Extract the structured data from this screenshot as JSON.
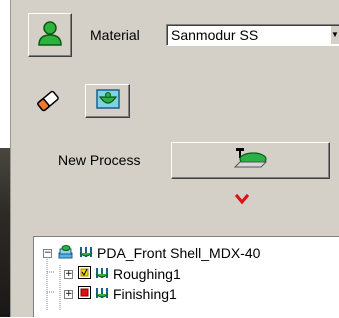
{
  "material": {
    "label": "Material",
    "selected": "Sanmodur SS"
  },
  "process": {
    "new_label": "New Process"
  },
  "tree": {
    "root": "PDA_Front Shell_MDX-40",
    "children": [
      {
        "label": "Roughing1",
        "box_color": "#f2d400"
      },
      {
        "label": "Finishing1",
        "box_color": "#e01010"
      }
    ]
  },
  "colors": {
    "panel": "#d4d0c8",
    "arrow": "#e01010",
    "user_icon": "#2db33d"
  },
  "icons": {
    "user": "user-icon",
    "eraser": "eraser-icon",
    "stock": "stock-bowl-icon",
    "new_process": "mill-tool-icon",
    "arrow": "red-down-arrow-icon"
  }
}
